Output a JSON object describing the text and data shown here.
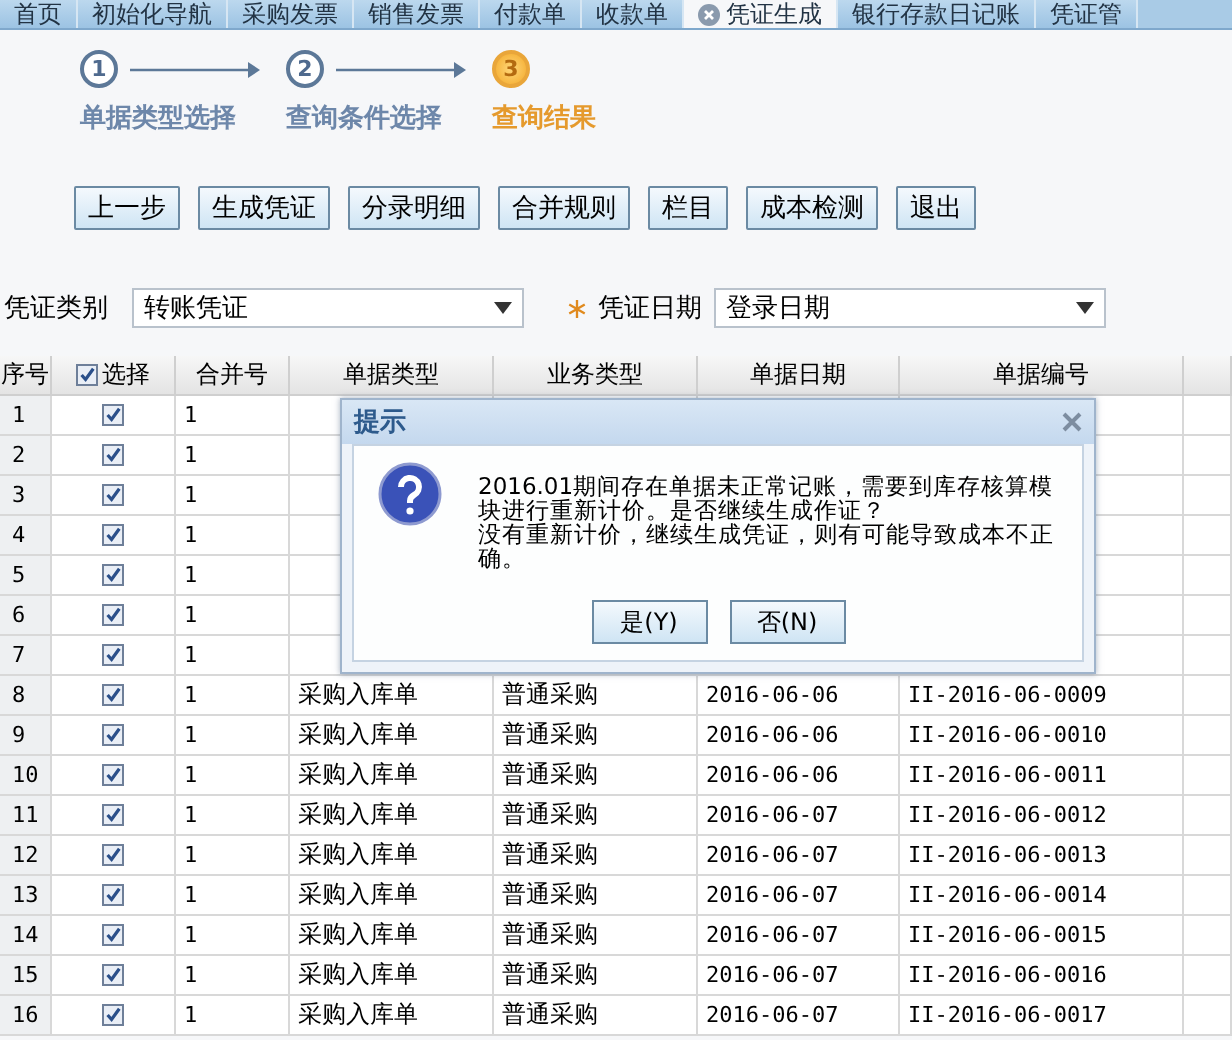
{
  "tabs": [
    {
      "label": "首页",
      "selected": false
    },
    {
      "label": "初始化导航",
      "selected": false
    },
    {
      "label": "采购发票",
      "selected": false
    },
    {
      "label": "销售发票",
      "selected": false
    },
    {
      "label": "付款单",
      "selected": false
    },
    {
      "label": "收款单",
      "selected": false
    },
    {
      "label": "凭证生成",
      "selected": true
    },
    {
      "label": "银行存款日记账",
      "selected": false
    },
    {
      "label": "凭证管",
      "selected": false
    }
  ],
  "steps": [
    {
      "number": "1",
      "label": "单据类型选择",
      "selected": false
    },
    {
      "number": "2",
      "label": "查询条件选择",
      "selected": false
    },
    {
      "number": "3",
      "label": "查询结果",
      "selected": true
    }
  ],
  "toolbar": [
    "上一步",
    "生成凭证",
    "分录明细",
    "合并规则",
    "栏目",
    "成本检测",
    "退出"
  ],
  "filters": [
    {
      "label": "凭证类别",
      "required": false,
      "value": "转账凭证"
    },
    {
      "label": "凭证日期",
      "required": true,
      "value": "登录日期"
    }
  ],
  "table": {
    "columns": [
      {
        "label": "序号",
        "kind": "text"
      },
      {
        "label": "选择",
        "kind": "check",
        "checked": true
      },
      {
        "label": "合并号",
        "kind": "text"
      },
      {
        "label": "单据类型",
        "kind": "text"
      },
      {
        "label": "业务类型",
        "kind": "text"
      },
      {
        "label": "单据日期",
        "kind": "text"
      },
      {
        "label": "单据编号",
        "kind": "text"
      }
    ],
    "rows": [
      {
        "no": "1",
        "checked": true,
        "merge": "1"
      },
      {
        "no": "2",
        "checked": true,
        "merge": "1"
      },
      {
        "no": "3",
        "checked": true,
        "merge": "1"
      },
      {
        "no": "4",
        "checked": true,
        "merge": "1"
      },
      {
        "no": "5",
        "checked": true,
        "merge": "1"
      },
      {
        "no": "6",
        "checked": true,
        "merge": "1"
      },
      {
        "no": "7",
        "checked": true,
        "merge": "1"
      },
      {
        "no": "8",
        "checked": true,
        "merge": "1",
        "type": "采购入库单",
        "business": "普通采购",
        "date": "2016-06-06",
        "code": "II-2016-06-0009"
      },
      {
        "no": "9",
        "checked": true,
        "merge": "1",
        "type": "采购入库单",
        "business": "普通采购",
        "date": "2016-06-06",
        "code": "II-2016-06-0010"
      },
      {
        "no": "10",
        "checked": true,
        "merge": "1",
        "type": "采购入库单",
        "business": "普通采购",
        "date": "2016-06-06",
        "code": "II-2016-06-0011"
      },
      {
        "no": "11",
        "checked": true,
        "merge": "1",
        "type": "采购入库单",
        "business": "普通采购",
        "date": "2016-06-07",
        "code": "II-2016-06-0012"
      },
      {
        "no": "12",
        "checked": true,
        "merge": "1",
        "type": "采购入库单",
        "business": "普通采购",
        "date": "2016-06-07",
        "code": "II-2016-06-0013"
      },
      {
        "no": "13",
        "checked": true,
        "merge": "1",
        "type": "采购入库单",
        "business": "普通采购",
        "date": "2016-06-07",
        "code": "II-2016-06-0014"
      },
      {
        "no": "14",
        "checked": true,
        "merge": "1",
        "type": "采购入库单",
        "business": "普通采购",
        "date": "2016-06-07",
        "code": "II-2016-06-0015"
      },
      {
        "no": "15",
        "checked": true,
        "merge": "1",
        "type": "采购入库单",
        "business": "普通采购",
        "date": "2016-06-07",
        "code": "II-2016-06-0016"
      },
      {
        "no": "16",
        "checked": true,
        "merge": "1",
        "type": "采购入库单",
        "business": "普通采购",
        "date": "2016-06-07",
        "code": "II-2016-06-0017"
      }
    ]
  },
  "dialog": {
    "title": "提示",
    "message": [
      "2016.01期间存在单据未正常记账，需要到库存核算模块进行重新计价。是否继续生成作证？",
      "没有重新计价，继续生成凭证，则有可能导致成本不正确。"
    ],
    "buttons": [
      "是(Y)",
      "否(N)"
    ]
  }
}
